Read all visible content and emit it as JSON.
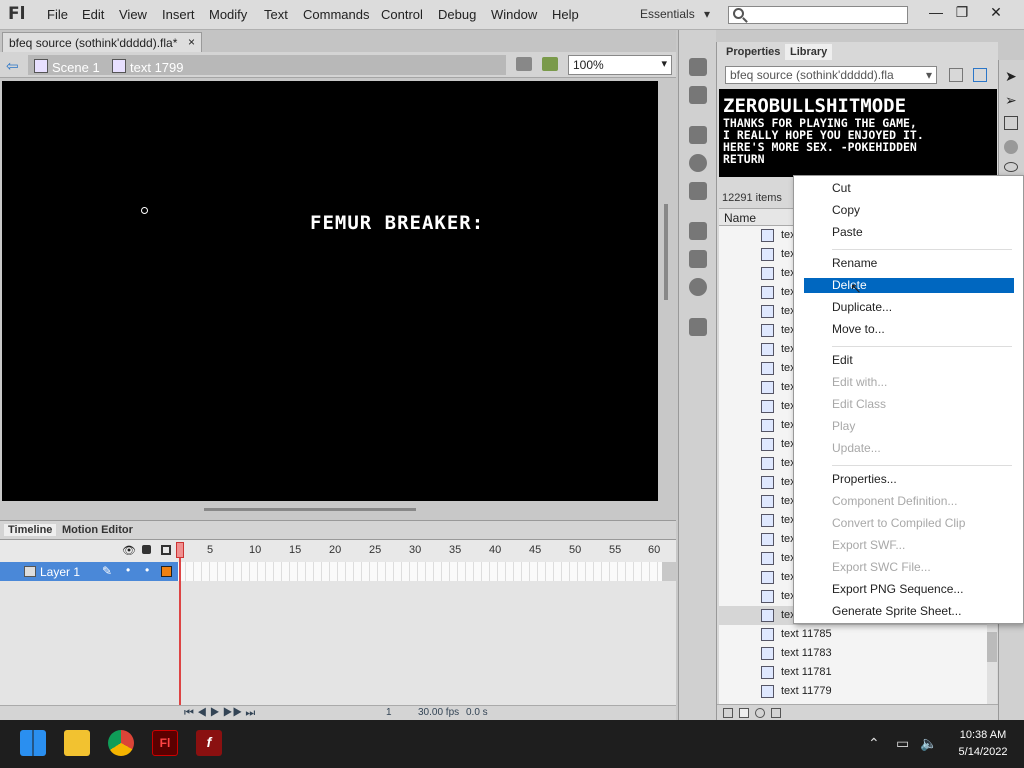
{
  "app": {
    "logo": "Fl",
    "menu": [
      "File",
      "Edit",
      "View",
      "Insert",
      "Modify",
      "Text",
      "Commands",
      "Control",
      "Debug",
      "Window",
      "Help"
    ],
    "workspace": "Essentials",
    "workspace_arrow": "▾",
    "window_controls": [
      "—",
      "❐",
      "✕"
    ]
  },
  "document": {
    "tab_title": "bfeq source (sothink'ddddd).fla*",
    "tab_close": "×"
  },
  "scene": {
    "scene_name": "Scene 1",
    "symbol_name": "text 1799",
    "zoom": "100%"
  },
  "stage": {
    "text": "FEMUR BREAKER:"
  },
  "timeline": {
    "tabs": [
      "Timeline",
      "Motion Editor"
    ],
    "frame_numbers": [
      "1",
      "5",
      "10",
      "15",
      "20",
      "25",
      "30",
      "35",
      "40",
      "45",
      "50",
      "55",
      "60"
    ],
    "layer_name": "Layer 1",
    "current_frame": "1",
    "fps": "30.00 fps",
    "time": "0.0 s"
  },
  "library": {
    "tabs": [
      "Properties",
      "Library"
    ],
    "document_select": "bfeq source (sothink'ddddd).fla",
    "preview_title": "ZEROBULLSHITMODE",
    "preview_lines": [
      "THANKS FOR PLAYING THE GAME,",
      "I REALLY HOPE YOU ENJOYED IT.",
      "HERE'S MORE SEX. -POKEHIDDEN",
      "RETURN"
    ],
    "item_count": "12291 items",
    "col_name": "Name",
    "truncated_label": "tex",
    "visible_items": [
      "text 11785",
      "text 11783",
      "text 11781",
      "text 11779"
    ]
  },
  "context_menu": {
    "groups": [
      [
        {
          "label": "Cut",
          "enabled": true
        },
        {
          "label": "Copy",
          "enabled": true
        },
        {
          "label": "Paste",
          "enabled": true
        }
      ],
      [
        {
          "label": "Rename",
          "enabled": true
        },
        {
          "label": "Delete",
          "enabled": true,
          "selected": true
        },
        {
          "label": "Duplicate...",
          "enabled": true
        },
        {
          "label": "Move to...",
          "enabled": true
        }
      ],
      [
        {
          "label": "Edit",
          "enabled": true
        },
        {
          "label": "Edit with...",
          "enabled": false
        },
        {
          "label": "Edit Class",
          "enabled": false
        },
        {
          "label": "Play",
          "enabled": false
        },
        {
          "label": "Update...",
          "enabled": false
        }
      ],
      [
        {
          "label": "Properties...",
          "enabled": true
        },
        {
          "label": "Component Definition...",
          "enabled": false
        },
        {
          "label": "Convert to Compiled Clip",
          "enabled": false
        },
        {
          "label": "Export SWF...",
          "enabled": false
        },
        {
          "label": "Export SWC File...",
          "enabled": false
        },
        {
          "label": "Export PNG Sequence...",
          "enabled": true
        },
        {
          "label": "Generate Sprite Sheet...",
          "enabled": true
        }
      ]
    ]
  },
  "taskbar": {
    "apps": [
      "windows-start-icon",
      "file-explorer-icon",
      "chrome-icon",
      "flash-pro-icon",
      "flash-player-icon"
    ],
    "time": "10:38 AM",
    "date": "5/14/2022"
  },
  "colors": {
    "selection_blue": "#0067c0",
    "layer_blue": "#4a88d8",
    "stage_black": "#000000"
  }
}
